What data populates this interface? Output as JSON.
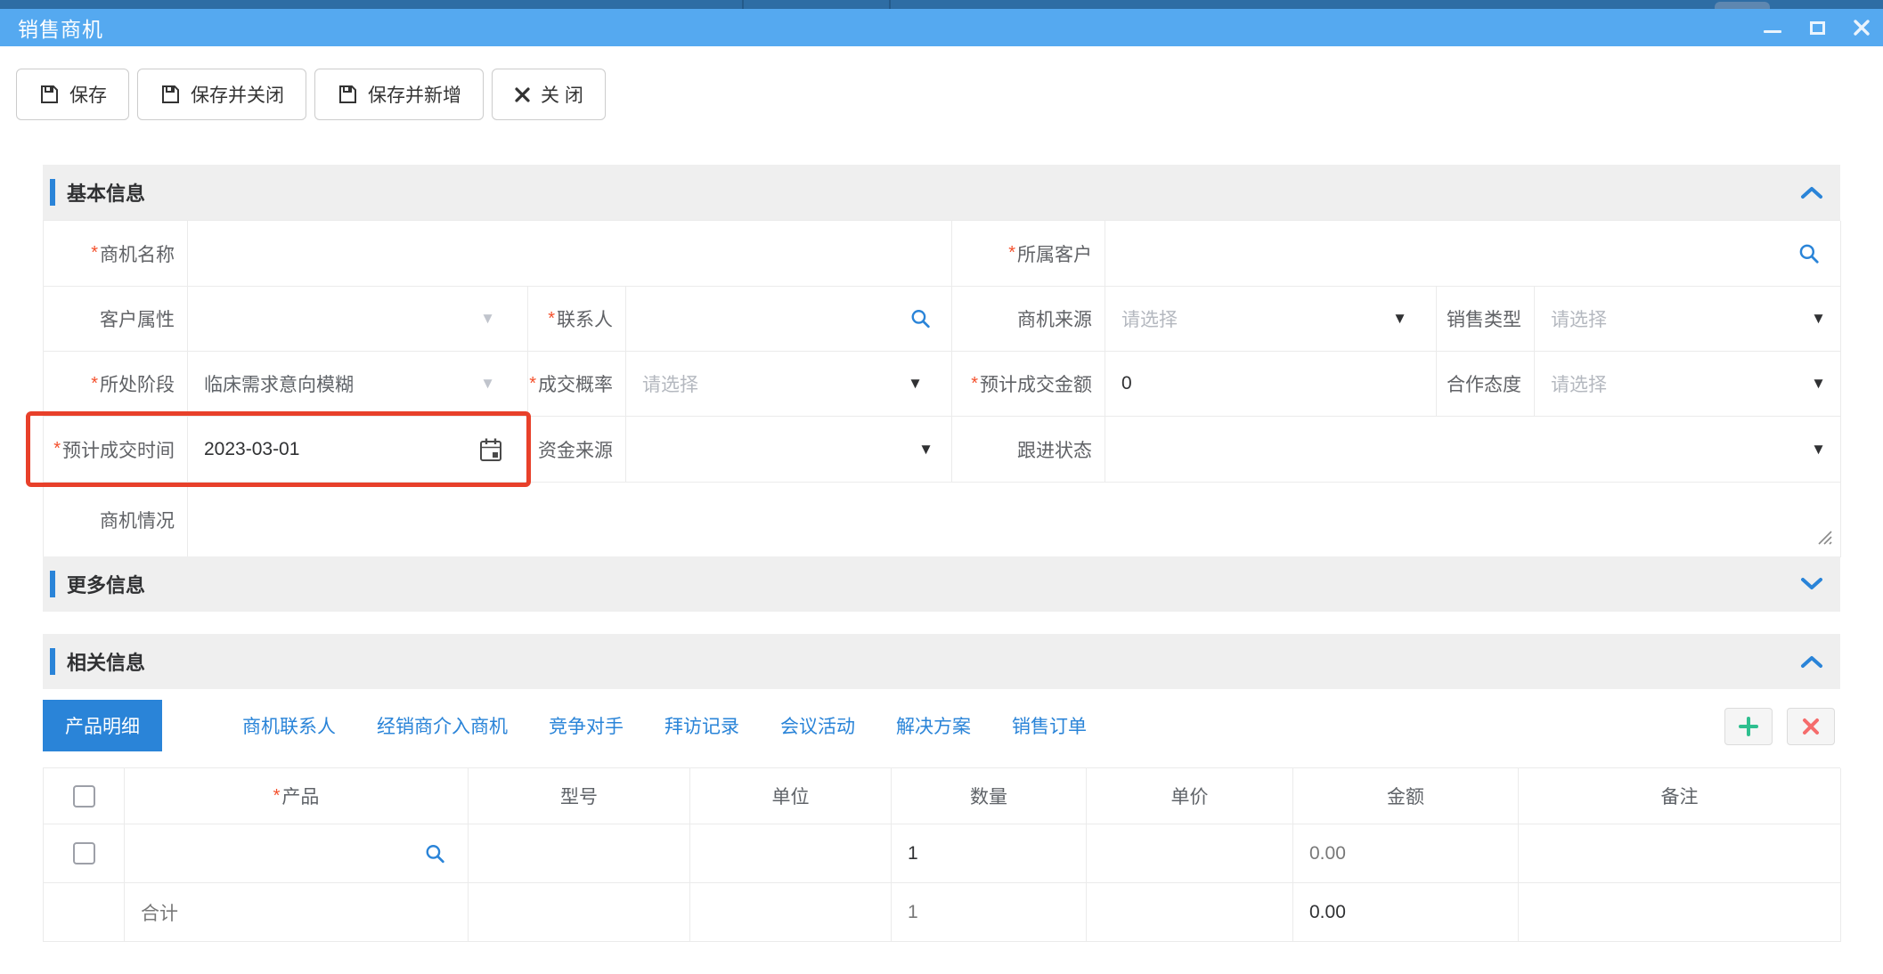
{
  "window": {
    "title": "销售商机"
  },
  "toolbar": {
    "save": "保存",
    "save_close": "保存并关闭",
    "save_new": "保存并新增",
    "close": "关 闭"
  },
  "ui": {
    "required_mark": "*"
  },
  "sections": {
    "basic": "基本信息",
    "more": "更多信息",
    "related": "相关信息"
  },
  "fields": {
    "name": {
      "label": "商机名称",
      "value": ""
    },
    "customer": {
      "label": "所属客户",
      "value": ""
    },
    "customer_attr": {
      "label": "客户属性",
      "value": ""
    },
    "contact": {
      "label": "联系人",
      "value": ""
    },
    "source": {
      "label": "商机来源",
      "placeholder": "请选择"
    },
    "sale_type": {
      "label": "销售类型",
      "placeholder": "请选择"
    },
    "stage": {
      "label": "所处阶段",
      "value": "临床需求意向模糊"
    },
    "probability": {
      "label": "成交概率",
      "placeholder": "请选择"
    },
    "amount": {
      "label": "预计成交金额",
      "value": "0"
    },
    "attitude": {
      "label": "合作态度",
      "placeholder": "请选择"
    },
    "close_date": {
      "label": "预计成交时间",
      "value": "2023-03-01"
    },
    "fund_source": {
      "label": "资金来源",
      "value": ""
    },
    "follow_status": {
      "label": "跟进状态",
      "value": ""
    },
    "situation": {
      "label": "商机情况",
      "value": ""
    }
  },
  "tabs": {
    "items": [
      {
        "label": "产品明细",
        "active": true
      },
      {
        "label": "商机联系人"
      },
      {
        "label": "经销商介入商机"
      },
      {
        "label": "竞争对手"
      },
      {
        "label": "拜访记录"
      },
      {
        "label": "会议活动"
      },
      {
        "label": "解决方案"
      },
      {
        "label": "销售订单"
      }
    ]
  },
  "product_table": {
    "headers": [
      "产品",
      "型号",
      "单位",
      "数量",
      "单价",
      "金额",
      "备注"
    ],
    "rows": [
      {
        "product": "",
        "model": "",
        "unit": "",
        "qty": "1",
        "price": "",
        "amount": "0.00",
        "note": ""
      }
    ],
    "total": {
      "label": "合计",
      "qty": "1",
      "amount": "0.00"
    }
  },
  "colors": {
    "titlebar": "#55a9f0",
    "accent": "#2a84d8",
    "highlight_ring": "#e8402a",
    "add": "#2fbf8f",
    "remove": "#f56c6c"
  }
}
